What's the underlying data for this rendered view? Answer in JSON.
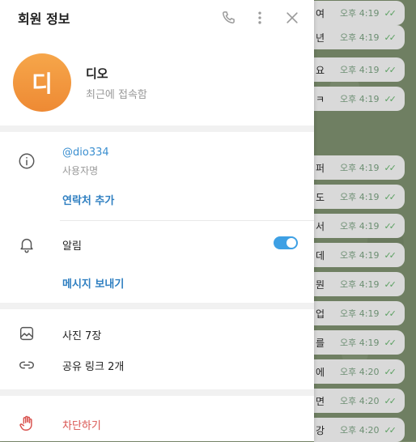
{
  "header": {
    "title": "회원 정보"
  },
  "profile": {
    "avatar_letter": "디",
    "name": "디오",
    "status": "최근에 접속함"
  },
  "info": {
    "username": "@dio334",
    "username_label": "사용자명",
    "add_contact": "연락처 추가",
    "notifications_label": "알림",
    "notifications_on": true,
    "send_message": "메시지 보내기"
  },
  "media": {
    "photos": "사진 7장",
    "shared_links": "공유 링크 2개"
  },
  "block": {
    "label": "차단하기"
  },
  "chat": {
    "messages": [
      {
        "text": "여",
        "time": "오후 4:19"
      },
      {
        "text": "년",
        "time": "오후 4:19"
      },
      {
        "text": "요",
        "time": "오후 4:19"
      },
      {
        "text": "ㅋ",
        "time": "오후 4:19"
      },
      {
        "text": "퍼",
        "time": "오후 4:19"
      },
      {
        "text": "도",
        "time": "오후 4:19"
      },
      {
        "text": "서",
        "time": "오후 4:19"
      },
      {
        "text": "데",
        "time": "오후 4:19"
      },
      {
        "text": "뭔",
        "time": "오후 4:19"
      },
      {
        "text": "업",
        "time": "오후 4:19"
      },
      {
        "text": "를",
        "time": "오후 4:19"
      },
      {
        "text": "에",
        "time": "오후 4:20"
      },
      {
        "text": "면",
        "time": "오후 4:20"
      },
      {
        "text": "강",
        "time": "오후 4:20"
      }
    ]
  }
}
